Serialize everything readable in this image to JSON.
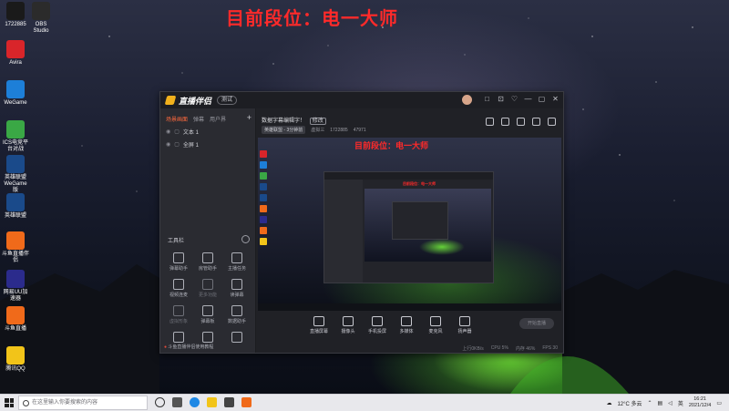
{
  "overlay": {
    "title": "目前段位：电一大师"
  },
  "desktop_icons": [
    {
      "label": "1722885",
      "color": "#1a1a1a"
    },
    {
      "label": "OBS Studio",
      "color": "#2b2b2b"
    },
    {
      "label": "Avira",
      "color": "#d9252a"
    },
    {
      "label": "WeGame",
      "color": "#1d7fd8"
    },
    {
      "label": "ICS电竞平台对战",
      "color": "#3aa845"
    },
    {
      "label": "英雄联盟WeGame版",
      "color": "#1a4a8a"
    },
    {
      "label": "英雄联盟",
      "color": "#1a4a8a"
    },
    {
      "label": "斗鱼直播伴侣",
      "color": "#f06a1a"
    },
    {
      "label": "网易UU加速器",
      "color": "#2b2b8c"
    },
    {
      "label": "斗鱼直播",
      "color": "#f06a1a"
    },
    {
      "label": "腾讯QQ",
      "color": "#f2c419"
    }
  ],
  "app": {
    "name": "直播伴侣",
    "version_badge": "测试",
    "window_controls": [
      "□",
      "⊡",
      "♡",
      "—",
      "▢",
      "✕"
    ],
    "tabs": [
      {
        "label": "场景画面",
        "active": true
      },
      {
        "label": "弹幕",
        "active": false
      },
      {
        "label": "用户界",
        "active": false
      }
    ],
    "add_label": "+",
    "scenes": [
      {
        "label": "文本 1"
      },
      {
        "label": "全屏 1"
      }
    ],
    "tools_heading": "工具栏",
    "tools": [
      {
        "label": "弹幕助手",
        "dim": false
      },
      {
        "label": "房管助手",
        "dim": false
      },
      {
        "label": "主播任务",
        "dim": false
      },
      {
        "label": "视频连麦",
        "dim": false
      },
      {
        "label": "更多功能",
        "dim": true
      },
      {
        "label": "读弹幕",
        "dim": false
      },
      {
        "label": "虚拟形象",
        "dim": true
      },
      {
        "label": "弹幕板",
        "dim": false
      },
      {
        "label": "数据助手",
        "dim": false
      },
      {
        "label": "",
        "dim": false
      },
      {
        "label": "",
        "dim": false
      },
      {
        "label": "",
        "dim": false
      }
    ],
    "sidebar_footer": "斗鱼直播伴侣使用教程",
    "room_title": "数据字幕编辑字！",
    "room_tag": "修改",
    "meta_category": "英雄联盟 - 3分钟前",
    "meta_uid": "1722885",
    "meta_fans": "47971",
    "meta_follow": "虚拟三",
    "preview_title": "目前段位：电一大师",
    "bottom_tools": [
      "直播屏幕",
      "摄像头",
      "手机投屏",
      "多媒体",
      "麦克风",
      "扬声器"
    ],
    "start_live": "开始直播",
    "status": [
      "上行0KB/s",
      "CPU 5%",
      "内存 46%",
      "FPS 30"
    ]
  },
  "taskbar": {
    "search_placeholder": "在这里输入你要搜索的内容",
    "weather": "12°C 多云",
    "time": "16:21",
    "date": "2021/12/4",
    "lang": "英"
  }
}
